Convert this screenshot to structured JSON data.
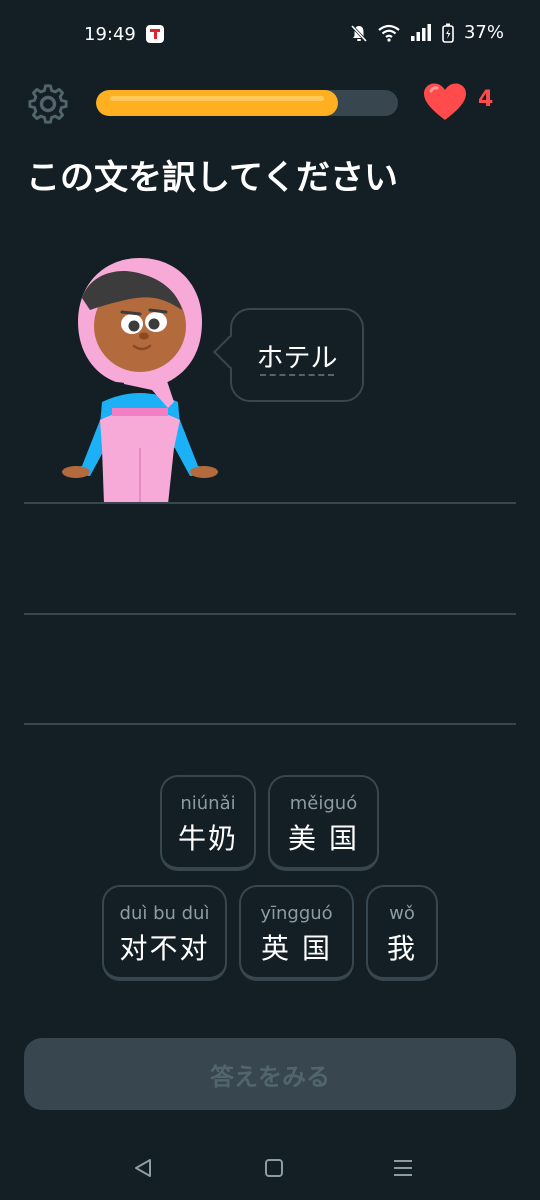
{
  "status_bar": {
    "time": "19:49",
    "battery": "37%"
  },
  "lesson": {
    "progress": 0.8,
    "hearts": "4"
  },
  "prompt": {
    "title": "この文を訳してください",
    "speech_text": "ホテル"
  },
  "word_bank": [
    {
      "pinyin": "niúnǎi",
      "hanzi": "牛奶"
    },
    {
      "pinyin": "měiguó",
      "hanzi": "美 国"
    },
    {
      "pinyin": "duì bu duì",
      "hanzi": "对不对"
    },
    {
      "pinyin": "yīngguó",
      "hanzi": "英 国"
    },
    {
      "pinyin": "wǒ",
      "hanzi": "我"
    }
  ],
  "footer": {
    "check_label": "答えをみる"
  },
  "colors": {
    "background": "#131f24",
    "border": "#37464f",
    "progress": "#ffb020",
    "heart": "#ff4b4b"
  }
}
